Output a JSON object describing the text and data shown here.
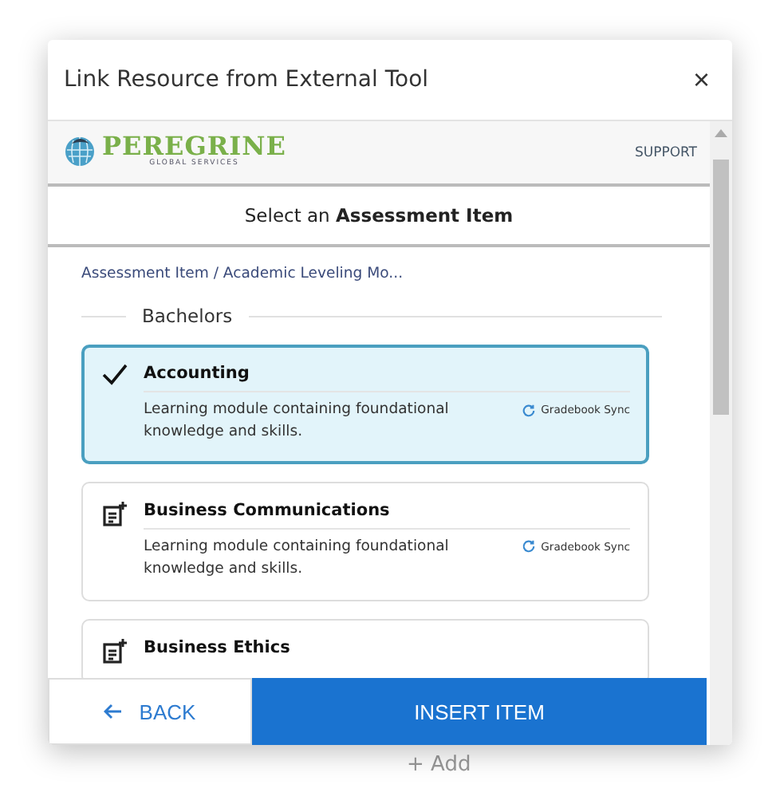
{
  "background": {
    "add_button": "+ Add"
  },
  "dialog": {
    "title": "Link Resource from External Tool",
    "close": "×"
  },
  "tool": {
    "logo_name": "PEREGRINE",
    "logo_sub": "GLOBAL SERVICES",
    "support": "SUPPORT",
    "heading": "Select an **Assessment Item**",
    "breadcrumb": "Assessment Item / Academic Leveling Mo...",
    "group": "Bachelors",
    "items": [
      {
        "title": "Accounting",
        "description": "Learning module containing foundational knowledge and skills.",
        "tag": "Gradebook Sync",
        "selected": true
      },
      {
        "title": "Business Communications",
        "description": "Learning module containing foundational knowledge and skills.",
        "tag": "Gradebook Sync",
        "selected": false
      },
      {
        "title": "Business Ethics",
        "selected": false
      }
    ]
  },
  "footer": {
    "back": "BACK",
    "insert": "INSERT ITEM"
  }
}
